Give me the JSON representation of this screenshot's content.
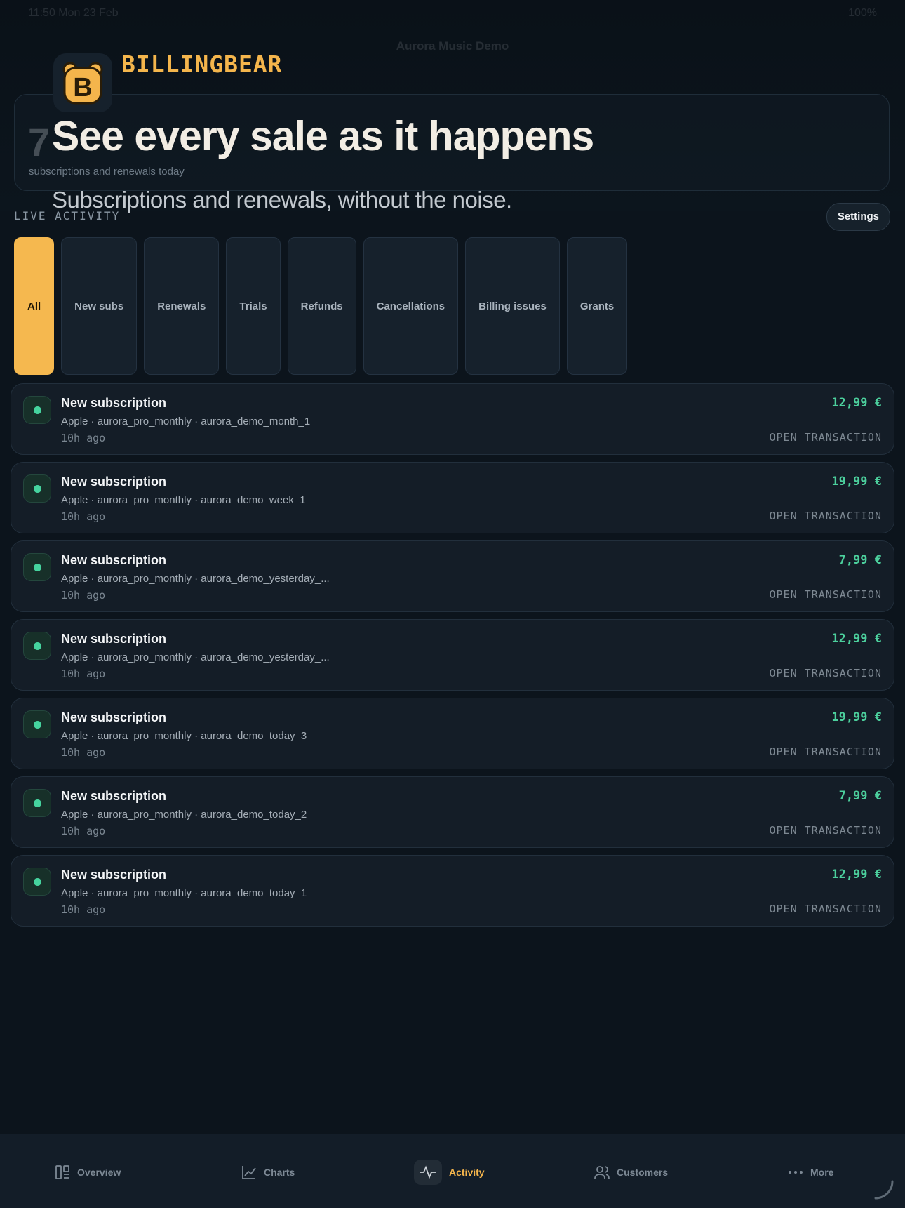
{
  "background": {
    "status_time": "11:50 Mon 23 Feb",
    "status_right": "100%",
    "app_switcher": "Aurora Music Demo",
    "summary_number": "7",
    "summary_caption": "subscriptions and renewals today"
  },
  "brand": {
    "name": "BILLINGBEAR",
    "logo_letter": "B",
    "headline": "See every sale as it happens",
    "subheadline": "Subscriptions and renewals, without the noise."
  },
  "section": {
    "label": "LIVE ACTIVITY",
    "settings_label": "Settings"
  },
  "filters": [
    {
      "label": "All",
      "active": true
    },
    {
      "label": "New subs",
      "active": false
    },
    {
      "label": "Renewals",
      "active": false
    },
    {
      "label": "Trials",
      "active": false
    },
    {
      "label": "Refunds",
      "active": false
    },
    {
      "label": "Cancellations",
      "active": false
    },
    {
      "label": "Billing issues",
      "active": false
    },
    {
      "label": "Grants",
      "active": false
    }
  ],
  "events": [
    {
      "title": "New subscription",
      "meta": "Apple · aurora_pro_monthly · aurora_demo_month_1",
      "time": "10h ago",
      "amount": "12,99 €",
      "action": "OPEN TRANSACTION"
    },
    {
      "title": "New subscription",
      "meta": "Apple · aurora_pro_monthly · aurora_demo_week_1",
      "time": "10h ago",
      "amount": "19,99 €",
      "action": "OPEN TRANSACTION"
    },
    {
      "title": "New subscription",
      "meta": "Apple · aurora_pro_monthly · aurora_demo_yesterday_...",
      "time": "10h ago",
      "amount": "7,99 €",
      "action": "OPEN TRANSACTION"
    },
    {
      "title": "New subscription",
      "meta": "Apple · aurora_pro_monthly · aurora_demo_yesterday_...",
      "time": "10h ago",
      "amount": "12,99 €",
      "action": "OPEN TRANSACTION"
    },
    {
      "title": "New subscription",
      "meta": "Apple · aurora_pro_monthly · aurora_demo_today_3",
      "time": "10h ago",
      "amount": "19,99 €",
      "action": "OPEN TRANSACTION"
    },
    {
      "title": "New subscription",
      "meta": "Apple · aurora_pro_monthly · aurora_demo_today_2",
      "time": "10h ago",
      "amount": "7,99 €",
      "action": "OPEN TRANSACTION"
    },
    {
      "title": "New subscription",
      "meta": "Apple · aurora_pro_monthly · aurora_demo_today_1",
      "time": "10h ago",
      "amount": "12,99 €",
      "action": "OPEN TRANSACTION"
    }
  ],
  "tabs": [
    {
      "label": "Overview",
      "icon": "overview-icon",
      "active": false
    },
    {
      "label": "Charts",
      "icon": "chart-icon",
      "active": false
    },
    {
      "label": "Activity",
      "icon": "activity-icon",
      "active": true
    },
    {
      "label": "Customers",
      "icon": "customers-icon",
      "active": false
    },
    {
      "label": "More",
      "icon": "more-icon",
      "active": false
    }
  ],
  "colors": {
    "accent": "#f5b84f",
    "positive": "#4cd09d",
    "background": "#0c141c"
  }
}
